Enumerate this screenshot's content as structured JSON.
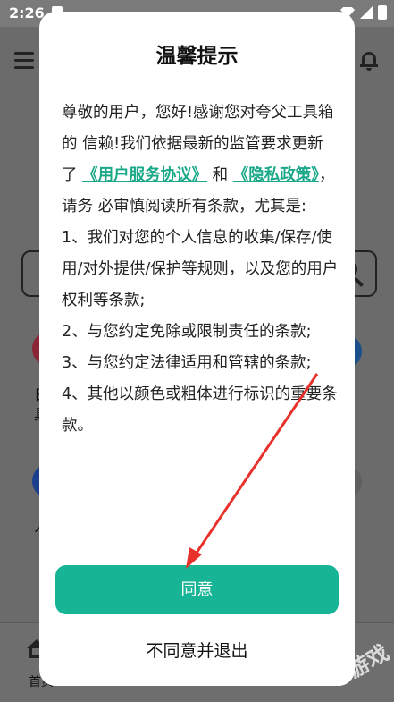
{
  "status_bar": {
    "time": "2:26"
  },
  "background_app": {
    "fragments": [
      "日",
      "具",
      "人"
    ],
    "nav": {
      "home_label": "首页"
    },
    "watermark": "游戏"
  },
  "dialog": {
    "title": "温馨提示",
    "intro_1": "尊敬的用户，您好!感谢您对夸父工具箱的 信赖!我们依据最新的监管要求更新了",
    "link_user_agreement": "《用户服务协议》",
    "and": " 和",
    "link_privacy_policy": "《隐私政策》",
    "intro_2": "，请务 必审慎阅读所有条款，尤其是:",
    "items": [
      " 1、我们对您的个人信息的收集/保存/使 用/对外提供/保护等规则，以及您的用户 权利等条款;",
      " 2、与您约定免除或限制责任的条款;",
      " 3、与您约定法律适用和管辖的条款;",
      " 4、其他以颜色或粗体进行标识的重要条 款。"
    ],
    "agree_button": "同意",
    "disagree_button": "不同意并退出"
  },
  "annotation": {
    "arrow_color": "#e8312b"
  }
}
